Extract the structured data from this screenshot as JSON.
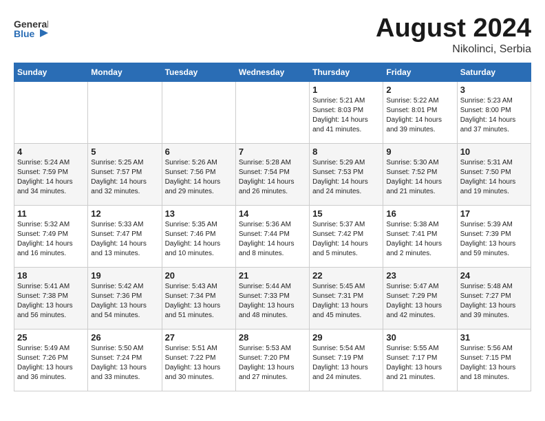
{
  "header": {
    "logo_general": "General",
    "logo_blue": "Blue",
    "month_title": "August 2024",
    "location": "Nikolinci, Serbia"
  },
  "weekdays": [
    "Sunday",
    "Monday",
    "Tuesday",
    "Wednesday",
    "Thursday",
    "Friday",
    "Saturday"
  ],
  "weeks": [
    [
      {
        "day": "",
        "info": ""
      },
      {
        "day": "",
        "info": ""
      },
      {
        "day": "",
        "info": ""
      },
      {
        "day": "",
        "info": ""
      },
      {
        "day": "1",
        "info": "Sunrise: 5:21 AM\nSunset: 8:03 PM\nDaylight: 14 hours\nand 41 minutes."
      },
      {
        "day": "2",
        "info": "Sunrise: 5:22 AM\nSunset: 8:01 PM\nDaylight: 14 hours\nand 39 minutes."
      },
      {
        "day": "3",
        "info": "Sunrise: 5:23 AM\nSunset: 8:00 PM\nDaylight: 14 hours\nand 37 minutes."
      }
    ],
    [
      {
        "day": "4",
        "info": "Sunrise: 5:24 AM\nSunset: 7:59 PM\nDaylight: 14 hours\nand 34 minutes."
      },
      {
        "day": "5",
        "info": "Sunrise: 5:25 AM\nSunset: 7:57 PM\nDaylight: 14 hours\nand 32 minutes."
      },
      {
        "day": "6",
        "info": "Sunrise: 5:26 AM\nSunset: 7:56 PM\nDaylight: 14 hours\nand 29 minutes."
      },
      {
        "day": "7",
        "info": "Sunrise: 5:28 AM\nSunset: 7:54 PM\nDaylight: 14 hours\nand 26 minutes."
      },
      {
        "day": "8",
        "info": "Sunrise: 5:29 AM\nSunset: 7:53 PM\nDaylight: 14 hours\nand 24 minutes."
      },
      {
        "day": "9",
        "info": "Sunrise: 5:30 AM\nSunset: 7:52 PM\nDaylight: 14 hours\nand 21 minutes."
      },
      {
        "day": "10",
        "info": "Sunrise: 5:31 AM\nSunset: 7:50 PM\nDaylight: 14 hours\nand 19 minutes."
      }
    ],
    [
      {
        "day": "11",
        "info": "Sunrise: 5:32 AM\nSunset: 7:49 PM\nDaylight: 14 hours\nand 16 minutes."
      },
      {
        "day": "12",
        "info": "Sunrise: 5:33 AM\nSunset: 7:47 PM\nDaylight: 14 hours\nand 13 minutes."
      },
      {
        "day": "13",
        "info": "Sunrise: 5:35 AM\nSunset: 7:46 PM\nDaylight: 14 hours\nand 10 minutes."
      },
      {
        "day": "14",
        "info": "Sunrise: 5:36 AM\nSunset: 7:44 PM\nDaylight: 14 hours\nand 8 minutes."
      },
      {
        "day": "15",
        "info": "Sunrise: 5:37 AM\nSunset: 7:42 PM\nDaylight: 14 hours\nand 5 minutes."
      },
      {
        "day": "16",
        "info": "Sunrise: 5:38 AM\nSunset: 7:41 PM\nDaylight: 14 hours\nand 2 minutes."
      },
      {
        "day": "17",
        "info": "Sunrise: 5:39 AM\nSunset: 7:39 PM\nDaylight: 13 hours\nand 59 minutes."
      }
    ],
    [
      {
        "day": "18",
        "info": "Sunrise: 5:41 AM\nSunset: 7:38 PM\nDaylight: 13 hours\nand 56 minutes."
      },
      {
        "day": "19",
        "info": "Sunrise: 5:42 AM\nSunset: 7:36 PM\nDaylight: 13 hours\nand 54 minutes."
      },
      {
        "day": "20",
        "info": "Sunrise: 5:43 AM\nSunset: 7:34 PM\nDaylight: 13 hours\nand 51 minutes."
      },
      {
        "day": "21",
        "info": "Sunrise: 5:44 AM\nSunset: 7:33 PM\nDaylight: 13 hours\nand 48 minutes."
      },
      {
        "day": "22",
        "info": "Sunrise: 5:45 AM\nSunset: 7:31 PM\nDaylight: 13 hours\nand 45 minutes."
      },
      {
        "day": "23",
        "info": "Sunrise: 5:47 AM\nSunset: 7:29 PM\nDaylight: 13 hours\nand 42 minutes."
      },
      {
        "day": "24",
        "info": "Sunrise: 5:48 AM\nSunset: 7:27 PM\nDaylight: 13 hours\nand 39 minutes."
      }
    ],
    [
      {
        "day": "25",
        "info": "Sunrise: 5:49 AM\nSunset: 7:26 PM\nDaylight: 13 hours\nand 36 minutes."
      },
      {
        "day": "26",
        "info": "Sunrise: 5:50 AM\nSunset: 7:24 PM\nDaylight: 13 hours\nand 33 minutes."
      },
      {
        "day": "27",
        "info": "Sunrise: 5:51 AM\nSunset: 7:22 PM\nDaylight: 13 hours\nand 30 minutes."
      },
      {
        "day": "28",
        "info": "Sunrise: 5:53 AM\nSunset: 7:20 PM\nDaylight: 13 hours\nand 27 minutes."
      },
      {
        "day": "29",
        "info": "Sunrise: 5:54 AM\nSunset: 7:19 PM\nDaylight: 13 hours\nand 24 minutes."
      },
      {
        "day": "30",
        "info": "Sunrise: 5:55 AM\nSunset: 7:17 PM\nDaylight: 13 hours\nand 21 minutes."
      },
      {
        "day": "31",
        "info": "Sunrise: 5:56 AM\nSunset: 7:15 PM\nDaylight: 13 hours\nand 18 minutes."
      }
    ]
  ]
}
